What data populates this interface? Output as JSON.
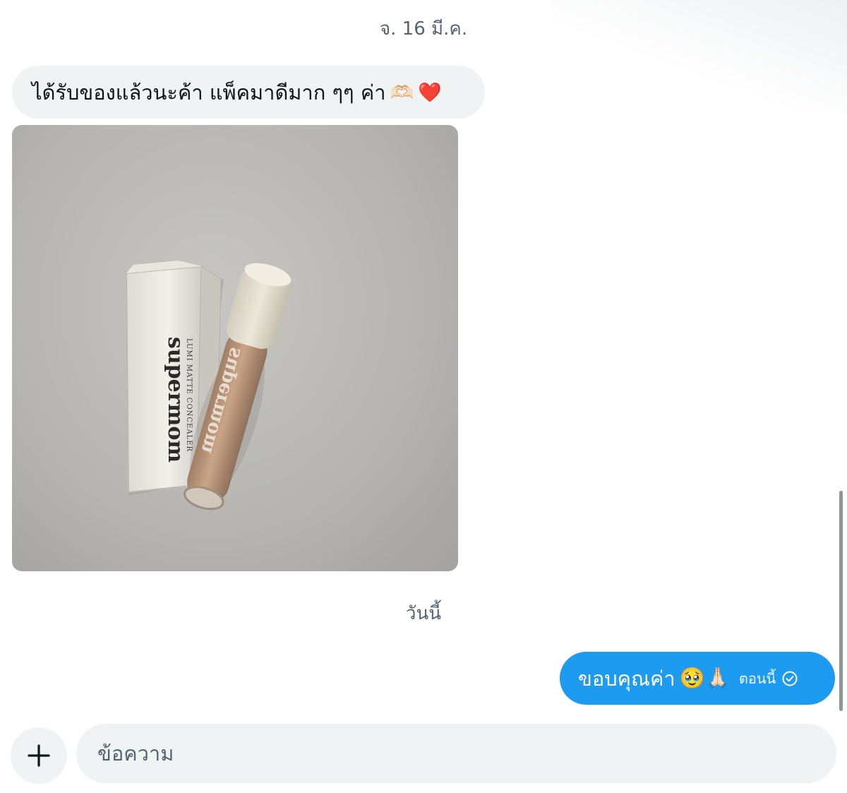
{
  "conversation": {
    "date_separator_1": "จ. 16 มี.ค.",
    "date_separator_2": "วันนี้",
    "incoming": {
      "text": "ได้รับของแล้วนะค้า แพ็คมาดีมาก ๆๆ ค่า",
      "emoji_1": "🫶🏻",
      "emoji_2": "❤️"
    },
    "photo": {
      "box_brand": "supermom",
      "box_product": "LUMI MATTE CONCEALER",
      "tube_brand": "supermom"
    },
    "outgoing": {
      "text": "ขอบคุณค่า",
      "emoji": "🥹🙏🏻",
      "timestamp": "ตอนนี้"
    }
  },
  "composer": {
    "placeholder": "ข้อความ"
  },
  "colors": {
    "accent": "#1d9bf0",
    "incoming_bubble": "#eff3f4",
    "secondary_text": "#536471"
  }
}
